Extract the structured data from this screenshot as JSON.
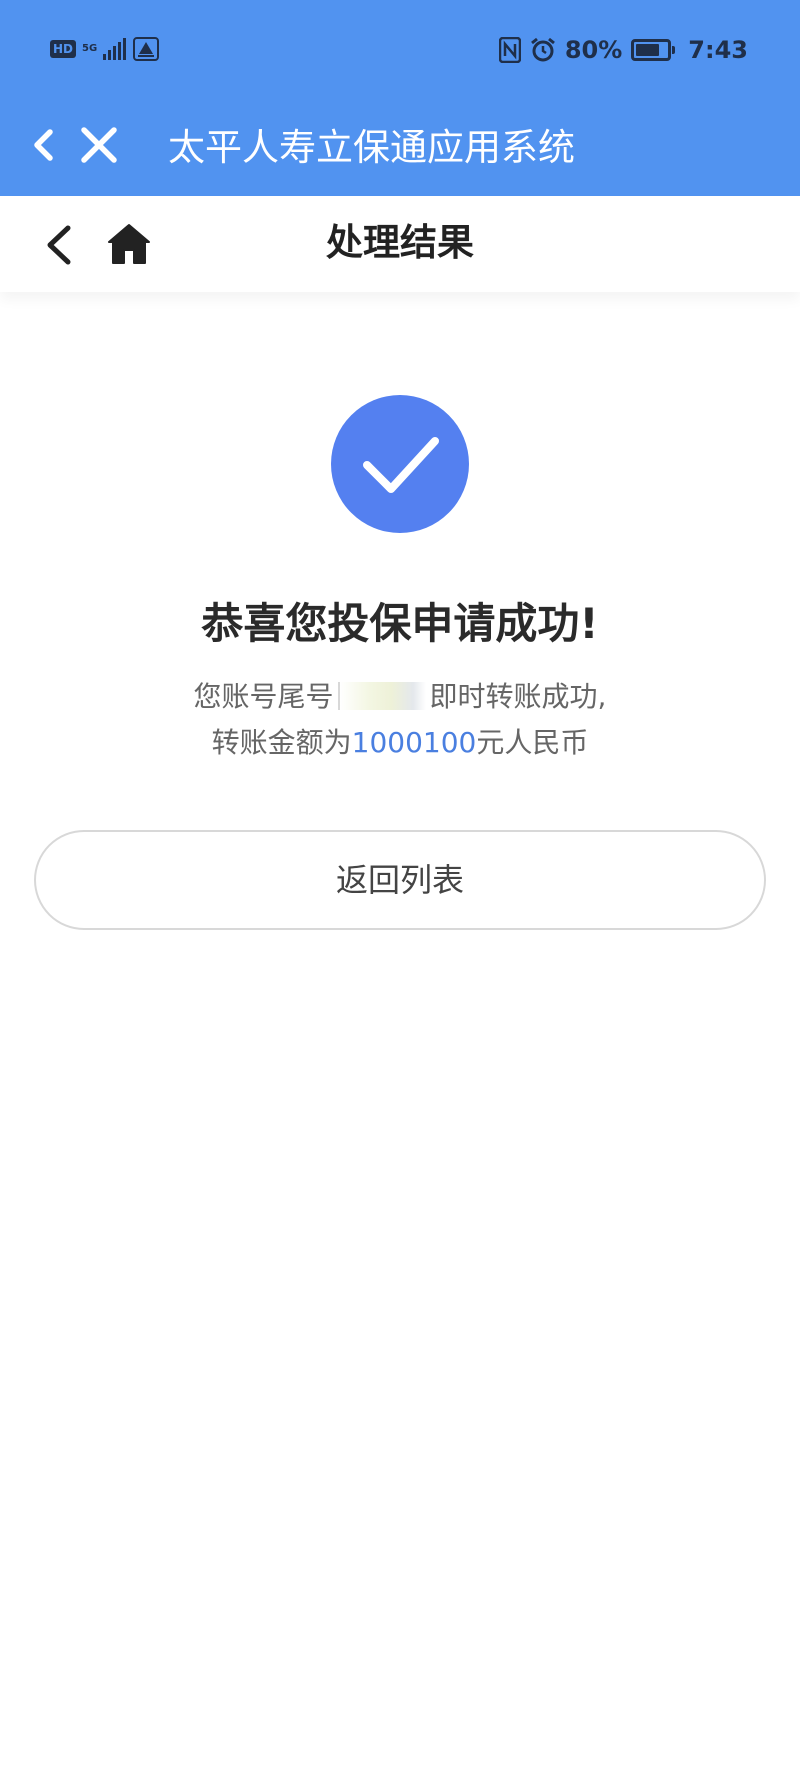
{
  "status_bar": {
    "hd": "HD",
    "network": "5G",
    "battery_percent": "80%",
    "battery_level": 0.8,
    "time": "7:43"
  },
  "header": {
    "title": "太平人寿立保通应用系统",
    "background": "#5193f0"
  },
  "page_nav": {
    "title": "处理结果"
  },
  "result": {
    "icon_color": "#5480f0",
    "title": "恭喜您投保申请成功!",
    "line1_prefix": "您账号尾号",
    "line1_suffix": "即时转账成功,",
    "line2_prefix": "转账金额为",
    "amount": "1000100",
    "line2_suffix": "元人民币"
  },
  "actions": {
    "return_label": "返回列表"
  }
}
